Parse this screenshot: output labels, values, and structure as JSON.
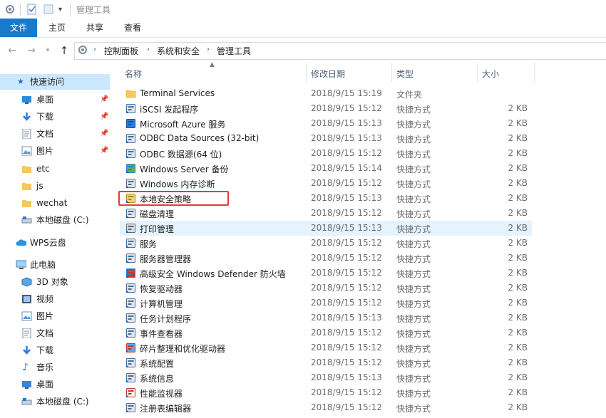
{
  "window": {
    "title": "管理工具"
  },
  "ribbon": {
    "tabs": [
      "文件",
      "主页",
      "共享",
      "查看"
    ]
  },
  "address": {
    "crumbs": [
      "控制面板",
      "系统和安全",
      "管理工具"
    ]
  },
  "sidebar": {
    "quick_access": "快速访问",
    "quick_items": [
      "桌面",
      "下载",
      "文档",
      "图片",
      "etc",
      "js",
      "wechat",
      "本地磁盘 (C:)"
    ],
    "wps": "WPS云盘",
    "this_pc": "此电脑",
    "pc_items": [
      "3D 对象",
      "视频",
      "图片",
      "文档",
      "下载",
      "音乐",
      "桌面",
      "本地磁盘 (C:)"
    ]
  },
  "columns": {
    "name": "名称",
    "date": "修改日期",
    "type": "类型",
    "size": "大小"
  },
  "files": [
    {
      "name": "Terminal Services",
      "date": "2018/9/15 15:19",
      "type": "文件夹",
      "size": "",
      "icon": "folder-icon"
    },
    {
      "name": "iSCSI 发起程序",
      "date": "2018/9/15 15:12",
      "type": "快捷方式",
      "size": "2 KB",
      "icon": "iscsi-icon"
    },
    {
      "name": "Microsoft Azure 服务",
      "date": "2018/9/15 15:13",
      "type": "快捷方式",
      "size": "2 KB",
      "icon": "azure-icon"
    },
    {
      "name": "ODBC Data Sources (32-bit)",
      "date": "2018/9/15 15:13",
      "type": "快捷方式",
      "size": "2 KB",
      "icon": "odbc-icon"
    },
    {
      "name": "ODBC 数据源(64 位)",
      "date": "2018/9/15 15:12",
      "type": "快捷方式",
      "size": "2 KB",
      "icon": "odbc-icon"
    },
    {
      "name": "Windows Server 备份",
      "date": "2018/9/15 15:14",
      "type": "快捷方式",
      "size": "2 KB",
      "icon": "backup-icon"
    },
    {
      "name": "Windows 内存诊断",
      "date": "2018/9/15 15:12",
      "type": "快捷方式",
      "size": "2 KB",
      "icon": "memory-icon"
    },
    {
      "name": "本地安全策略",
      "date": "2018/9/15 15:13",
      "type": "快捷方式",
      "size": "2 KB",
      "icon": "security-policy-icon"
    },
    {
      "name": "磁盘清理",
      "date": "2018/9/15 15:12",
      "type": "快捷方式",
      "size": "2 KB",
      "icon": "disk-cleanup-icon"
    },
    {
      "name": "打印管理",
      "date": "2018/9/15 15:13",
      "type": "快捷方式",
      "size": "2 KB",
      "icon": "printer-icon"
    },
    {
      "name": "服务",
      "date": "2018/9/15 15:12",
      "type": "快捷方式",
      "size": "2 KB",
      "icon": "services-icon"
    },
    {
      "name": "服务器管理器",
      "date": "2018/9/15 15:12",
      "type": "快捷方式",
      "size": "2 KB",
      "icon": "server-manager-icon"
    },
    {
      "name": "高级安全 Windows Defender 防火墙",
      "date": "2018/9/15 15:12",
      "type": "快捷方式",
      "size": "2 KB",
      "icon": "firewall-icon"
    },
    {
      "name": "恢复驱动器",
      "date": "2018/9/15 15:12",
      "type": "快捷方式",
      "size": "2 KB",
      "icon": "recovery-icon"
    },
    {
      "name": "计算机管理",
      "date": "2018/9/15 15:12",
      "type": "快捷方式",
      "size": "2 KB",
      "icon": "computer-management-icon"
    },
    {
      "name": "任务计划程序",
      "date": "2018/9/15 15:13",
      "type": "快捷方式",
      "size": "2 KB",
      "icon": "task-scheduler-icon"
    },
    {
      "name": "事件查看器",
      "date": "2018/9/15 15:12",
      "type": "快捷方式",
      "size": "2 KB",
      "icon": "event-viewer-icon"
    },
    {
      "name": "碎片整理和优化驱动器",
      "date": "2018/9/15 15:12",
      "type": "快捷方式",
      "size": "2 KB",
      "icon": "defrag-icon"
    },
    {
      "name": "系统配置",
      "date": "2018/9/15 15:12",
      "type": "快捷方式",
      "size": "2 KB",
      "icon": "system-config-icon"
    },
    {
      "name": "系统信息",
      "date": "2018/9/15 15:13",
      "type": "快捷方式",
      "size": "2 KB",
      "icon": "system-info-icon"
    },
    {
      "name": "性能监视器",
      "date": "2018/9/15 15:12",
      "type": "快捷方式",
      "size": "2 KB",
      "icon": "perf-monitor-icon"
    },
    {
      "name": "注册表编辑器",
      "date": "2018/9/15 15:12",
      "type": "快捷方式",
      "size": "2 KB",
      "icon": "regedit-icon"
    }
  ],
  "colors": {
    "accent": "#1979ca",
    "selection": "#cce8ff",
    "hover": "#e5f3ff",
    "highlight_box": "#e13c3c",
    "folder": "#f7c85a"
  }
}
